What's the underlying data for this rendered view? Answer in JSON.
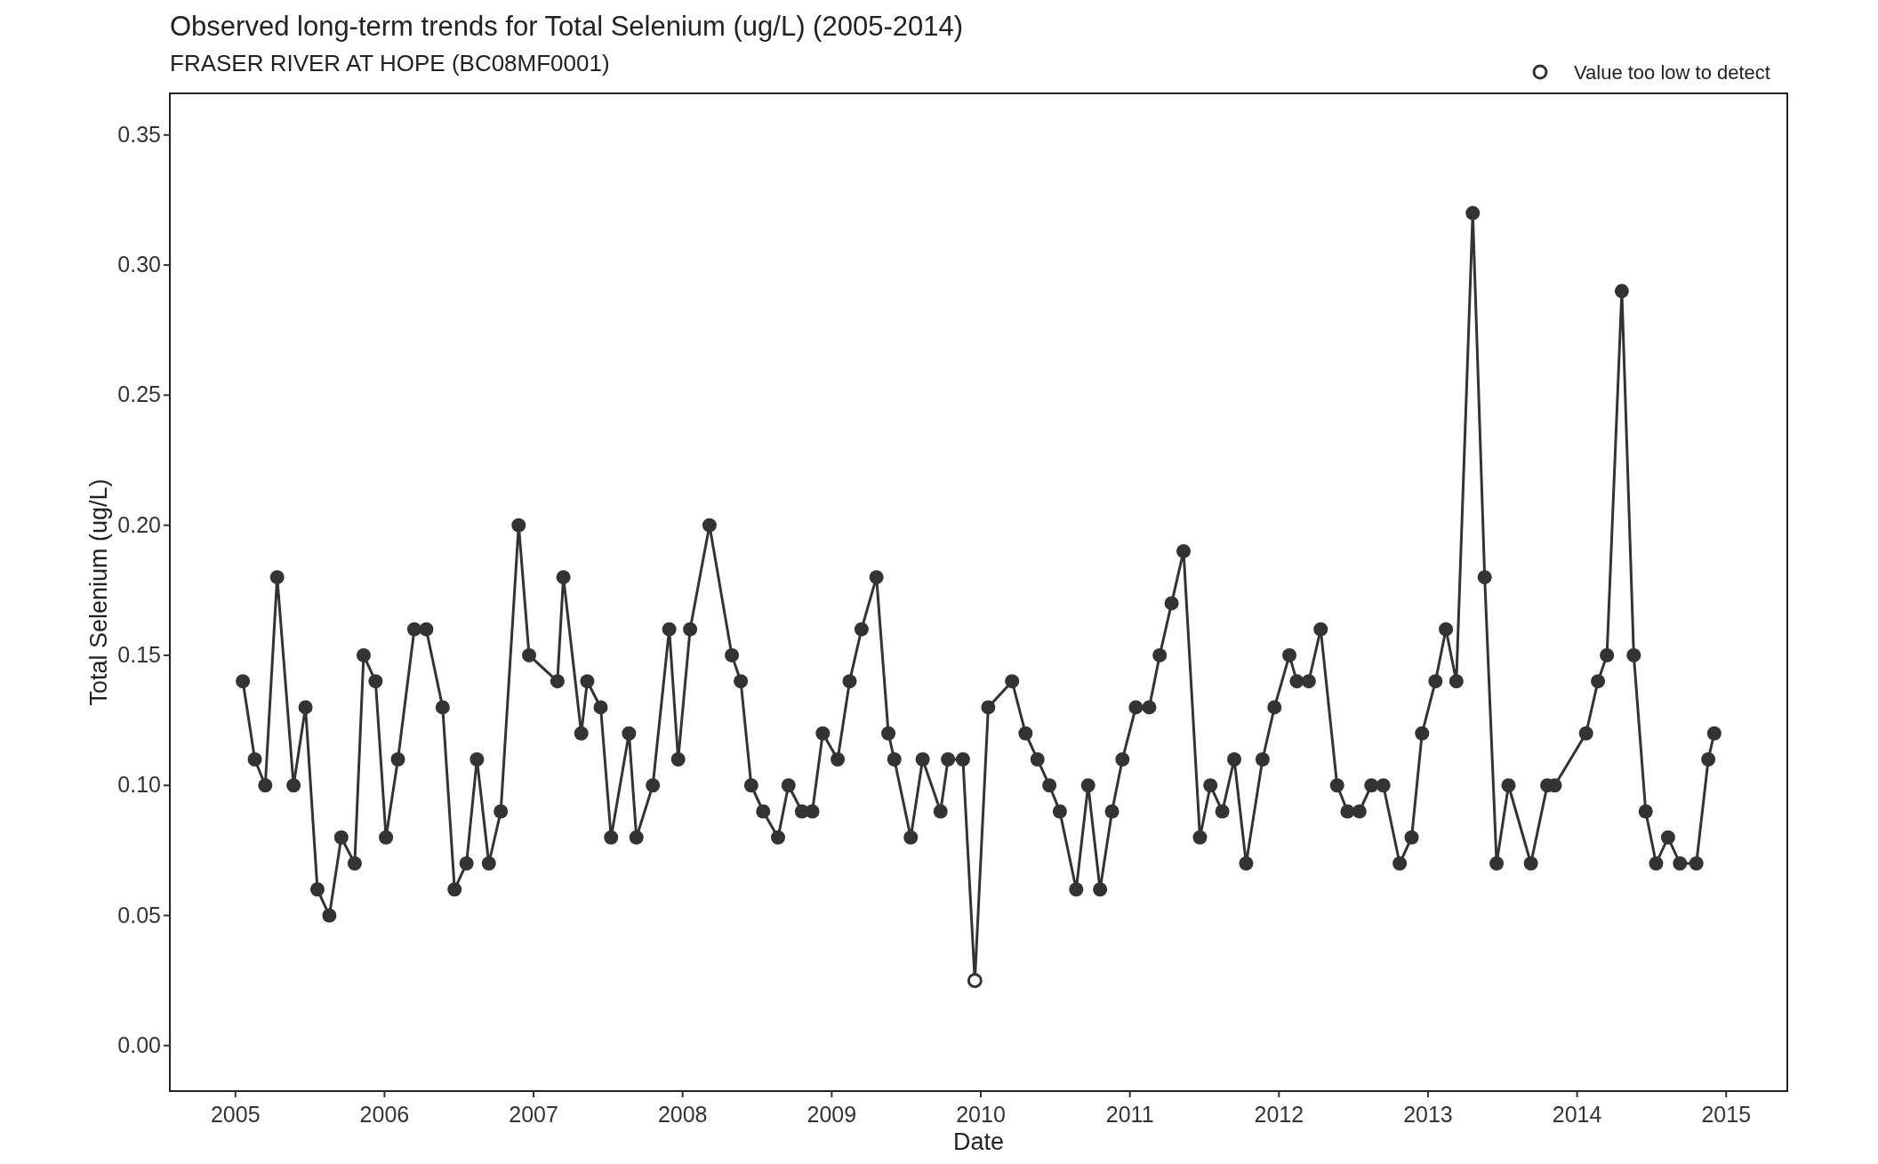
{
  "title": "Observed long-term trends for Total Selenium (ug/L) (2005-2014)",
  "subtitle": "FRASER RIVER AT HOPE (BC08MF0001)",
  "chart_data": {
    "type": "line",
    "xlabel": "Date",
    "ylabel": "Total Selenium (ug/L)",
    "x": [
      2005.05,
      2005.13,
      2005.2,
      2005.28,
      2005.39,
      2005.47,
      2005.55,
      2005.63,
      2005.71,
      2005.8,
      2005.86,
      2005.94,
      2006.01,
      2006.09,
      2006.2,
      2006.28,
      2006.39,
      2006.47,
      2006.55,
      2006.62,
      2006.7,
      2006.78,
      2006.9,
      2006.97,
      2007.16,
      2007.2,
      2007.32,
      2007.36,
      2007.45,
      2007.52,
      2007.64,
      2007.69,
      2007.8,
      2007.91,
      2007.97,
      2008.05,
      2008.18,
      2008.33,
      2008.39,
      2008.46,
      2008.54,
      2008.64,
      2008.71,
      2008.8,
      2008.87,
      2008.94,
      2009.04,
      2009.12,
      2009.2,
      2009.3,
      2009.38,
      2009.42,
      2009.53,
      2009.61,
      2009.73,
      2009.78,
      2009.88,
      2009.96,
      2010.05,
      2010.21,
      2010.3,
      2010.38,
      2010.46,
      2010.53,
      2010.64,
      2010.72,
      2010.8,
      2010.88,
      2010.95,
      2011.04,
      2011.13,
      2011.2,
      2011.28,
      2011.36,
      2011.47,
      2011.54,
      2011.62,
      2011.7,
      2011.78,
      2011.89,
      2011.97,
      2012.07,
      2012.12,
      2012.2,
      2012.28,
      2012.39,
      2012.46,
      2012.54,
      2012.62,
      2012.7,
      2012.81,
      2012.89,
      2012.96,
      2013.05,
      2013.12,
      2013.19,
      2013.3,
      2013.38,
      2013.46,
      2013.54,
      2013.69,
      2013.8,
      2013.85,
      2014.06,
      2014.14,
      2014.2,
      2014.3,
      2014.38,
      2014.46,
      2014.53,
      2014.61,
      2014.69,
      2014.8,
      2014.88,
      2014.92
    ],
    "series": [
      {
        "color": "#333333",
        "marker": "circle",
        "values": [
          0.14,
          0.11,
          0.1,
          0.18,
          0.1,
          0.13,
          0.06,
          0.05,
          0.08,
          0.07,
          0.15,
          0.14,
          0.08,
          0.11,
          0.16,
          0.16,
          0.13,
          0.06,
          0.07,
          0.11,
          0.07,
          0.09,
          0.2,
          0.15,
          0.14,
          0.18,
          0.12,
          0.14,
          0.13,
          0.08,
          0.12,
          0.08,
          0.1,
          0.16,
          0.11,
          0.16,
          0.2,
          0.15,
          0.14,
          0.1,
          0.09,
          0.08,
          0.1,
          0.09,
          0.09,
          0.12,
          0.11,
          0.14,
          0.16,
          0.18,
          0.12,
          0.11,
          0.08,
          0.11,
          0.09,
          0.11,
          0.11,
          0.025,
          0.13,
          0.14,
          0.12,
          0.11,
          0.1,
          0.09,
          0.06,
          0.1,
          0.06,
          0.09,
          0.11,
          0.13,
          0.13,
          0.15,
          0.17,
          0.19,
          0.08,
          0.1,
          0.09,
          0.11,
          0.07,
          0.11,
          0.13,
          0.15,
          0.14,
          0.14,
          0.16,
          0.1,
          0.09,
          0.09,
          0.1,
          0.1,
          0.07,
          0.08,
          0.12,
          0.14,
          0.16,
          0.14,
          0.32,
          0.18,
          0.07,
          0.1,
          0.07,
          0.1,
          0.1,
          0.12,
          0.14,
          0.15,
          0.29,
          0.15,
          0.09,
          0.07,
          0.08,
          0.07,
          0.07,
          0.11,
          0.12
        ]
      },
      {
        "name": "Value too low to detect",
        "color": "#333333",
        "marker": "open_circle",
        "values": [
          null,
          null,
          null,
          null,
          null,
          null,
          null,
          null,
          null,
          null,
          null,
          null,
          null,
          null,
          null,
          null,
          null,
          null,
          null,
          null,
          null,
          null,
          null,
          null,
          null,
          null,
          null,
          null,
          null,
          null,
          null,
          null,
          null,
          null,
          null,
          null,
          null,
          null,
          null,
          null,
          null,
          null,
          null,
          null,
          null,
          null,
          null,
          null,
          null,
          null,
          null,
          null,
          null,
          null,
          null,
          null,
          null,
          0.025,
          null,
          null,
          null,
          null,
          null,
          null,
          null,
          null,
          null,
          null,
          null,
          null,
          null,
          null,
          null,
          null,
          null,
          null,
          null,
          null,
          null,
          null,
          null,
          null,
          null,
          null,
          null,
          null,
          null,
          null,
          null,
          null,
          null,
          null,
          null,
          null,
          null,
          null,
          null,
          null,
          null,
          null,
          null,
          null,
          null,
          null,
          null,
          null,
          null,
          null,
          null,
          null,
          null,
          null,
          null,
          null,
          null
        ]
      }
    ],
    "xlim": [
      2004.56,
      2015.41
    ],
    "ylim": [
      -0.0175,
      0.366
    ],
    "xticks": [
      2005,
      2006,
      2007,
      2008,
      2009,
      2010,
      2011,
      2012,
      2013,
      2014,
      2015
    ],
    "yticks": [
      {
        "value": 0,
        "label": "0.00"
      },
      {
        "value": 0.05,
        "label": "0.05"
      },
      {
        "value": 0.1,
        "label": "0.10"
      },
      {
        "value": 0.15,
        "label": "0.15"
      },
      {
        "value": 0.2,
        "label": "0.20"
      },
      {
        "value": 0.25,
        "label": "0.25"
      },
      {
        "value": 0.3,
        "label": "0.30"
      },
      {
        "value": 0.35,
        "label": "0.35"
      }
    ]
  }
}
